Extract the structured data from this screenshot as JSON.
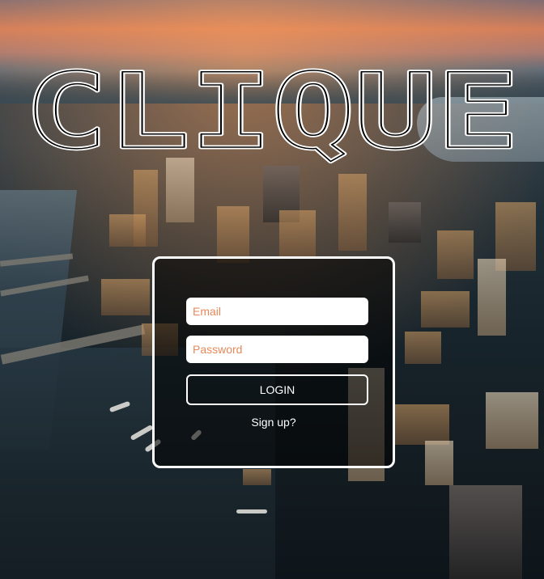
{
  "brand": {
    "logo_text": "CLIQUE"
  },
  "login": {
    "email_placeholder": "Email",
    "password_placeholder": "Password",
    "login_label": "LOGIN",
    "signup_label": "Sign up?"
  },
  "colors": {
    "placeholder_accent": "#e6895a",
    "card_border": "#ffffff"
  }
}
